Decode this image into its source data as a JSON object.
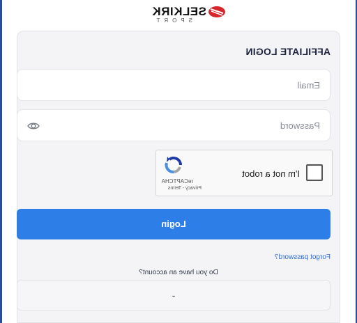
{
  "brand": {
    "name": "SELKIRK",
    "sub": "SPORT",
    "accent": "#d7262b"
  },
  "login": {
    "title": "AFFILIATE LOGIN",
    "email_placeholder": "Email",
    "password_placeholder": "Password",
    "button_label": "Login",
    "forgot_label": "Forgot password?",
    "no_account_text": "Do you have an account?",
    "signup_label": "-"
  },
  "captcha": {
    "label": "I'm not a robot",
    "brand": "reCAPTCHA",
    "links": "Privacy - Terms"
  },
  "colors": {
    "primary": "#2d7ee6",
    "frame": "#2a4f9a",
    "title": "#1c2240"
  },
  "icons": {
    "password_toggle": "eye-icon",
    "captcha_logo": "recaptcha-icon",
    "brand_logo": "selkirk-logo-icon"
  }
}
